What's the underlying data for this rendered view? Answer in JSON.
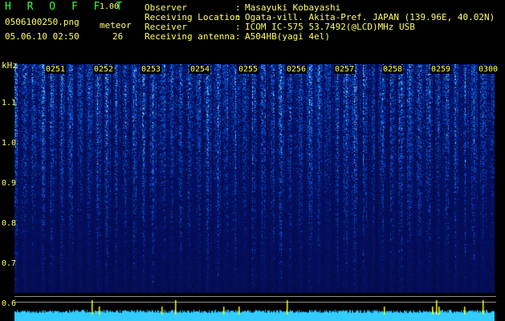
{
  "header": {
    "app_title": "H R O F F T",
    "version": "1.00",
    "file_name": "0506100250.png",
    "timestamp": "05.06.10 02:50",
    "meteor_label": "meteor",
    "meteor_count": "26"
  },
  "station_info": [
    {
      "label": "Observer",
      "value": "Masayuki Kobayashi"
    },
    {
      "label": "Receiving Location",
      "value": "Ogata-vill. Akita-Pref. JAPAN (139.96E, 40.02N)"
    },
    {
      "label": "Receiver",
      "value": "ICOM IC-575 53.7492(@LCD)MHz USB"
    },
    {
      "label": "Receiving antenna",
      "value": "A504HB(yagi 4el)"
    }
  ],
  "separator": ":",
  "spectrogram": {
    "y_unit": "kHz",
    "y_ticks": [
      "1.1",
      "1.0",
      "0.9",
      "0.8",
      "0.7",
      "0.6"
    ],
    "time_ticks": [
      "0251",
      "0252",
      "0253",
      "0254",
      "0255",
      "0256",
      "0257",
      "0258",
      "0259",
      "0300"
    ],
    "colors": {
      "background": "#000000",
      "noise_low": "#0a1a8c",
      "noise_high": "#3aa0ff",
      "meteor": "#ffff00",
      "baseline": "#33ccff"
    }
  }
}
